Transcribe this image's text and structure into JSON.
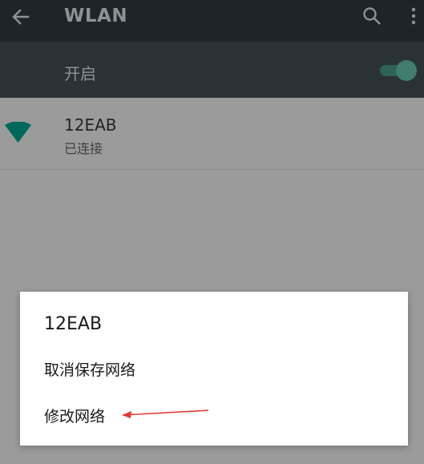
{
  "appbar": {
    "title": "WLAN",
    "back_icon": "arrow-back-icon",
    "search_icon": "search-icon",
    "more_icon": "more-vert-icon"
  },
  "toggle": {
    "label": "开启",
    "on": true
  },
  "network": {
    "name": "12EAB",
    "status": "已连接",
    "icon": "wifi-full-icon"
  },
  "dialog": {
    "title": "12EAB",
    "items": [
      {
        "label": "取消保存网络"
      },
      {
        "label": "修改网络"
      }
    ]
  },
  "colors": {
    "accent": "#00796b",
    "annotation_arrow": "#e53935",
    "dim_overlay": "#9b9b9b"
  }
}
